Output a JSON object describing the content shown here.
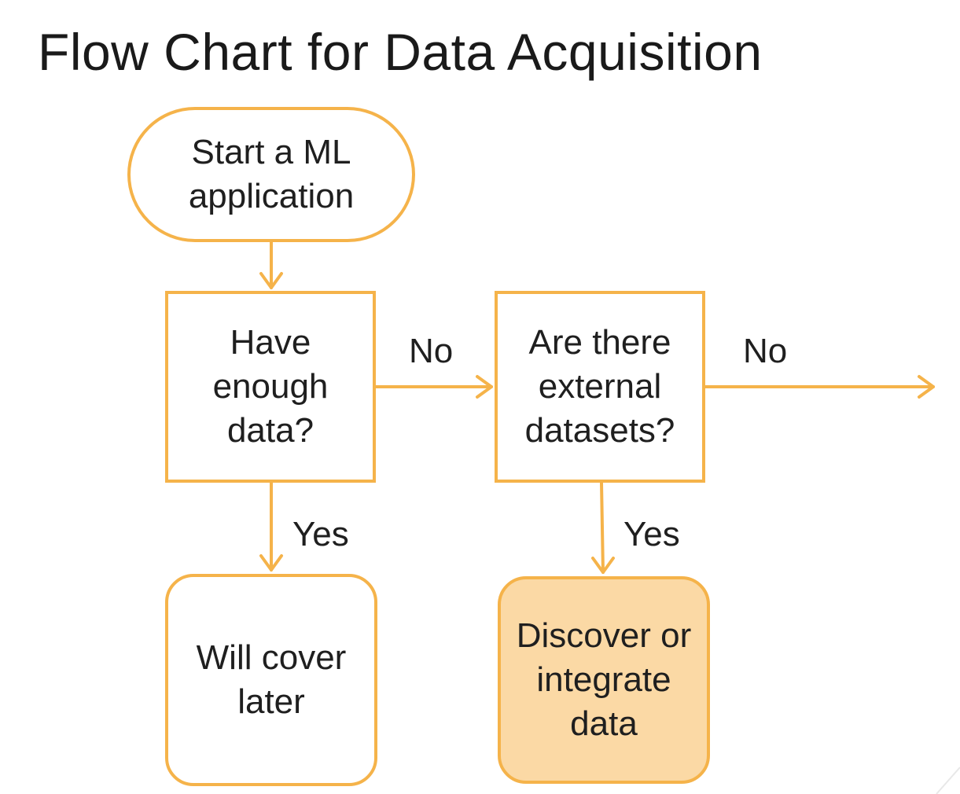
{
  "title": "Flow Chart for Data Acquisition",
  "colors": {
    "stroke": "#f5b34a",
    "highlight_fill": "#fbd9a5",
    "text": "#1f1f1f"
  },
  "nodes": {
    "start": {
      "text": "Start a ML\napplication"
    },
    "enough_data": {
      "text": "Have\nenough\ndata?"
    },
    "external_datasets": {
      "text": "Are there\nexternal\ndatasets?"
    },
    "will_cover_later": {
      "text": "Will cover\nlater"
    },
    "discover_integrate": {
      "text": "Discover or\nintegrate\ndata"
    }
  },
  "edges": {
    "enough_no": "No",
    "external_no": "No",
    "enough_yes": "Yes",
    "external_yes": "Yes"
  }
}
